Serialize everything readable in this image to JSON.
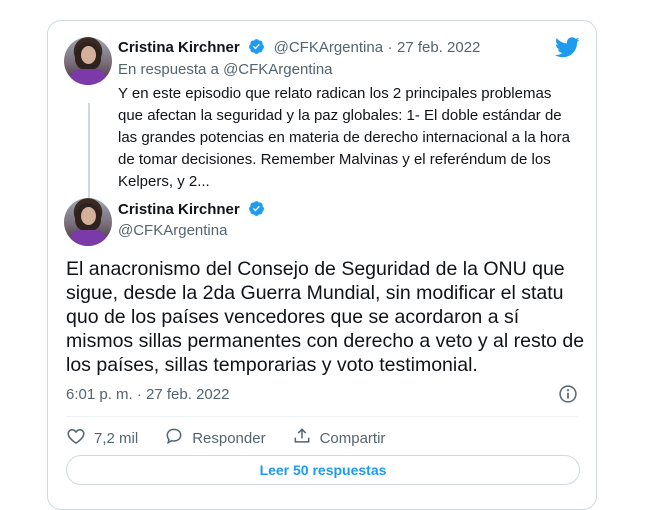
{
  "reply_tweet": {
    "author_name": "Cristina Kirchner",
    "handle": "@CFKArgentina",
    "separator": "·",
    "date": "27 feb. 2022",
    "replying_to": "En respuesta a @CFKArgentina",
    "text": "Y en este episodio que relato radican los 2 principales problemas que afectan la seguridad y la paz globales: 1- El doble estándar de las grandes potencias en materia de derecho internacional a la hora de tomar decisiones. Remember Malvinas y el referéndum de los Kelpers, y 2..."
  },
  "main_tweet": {
    "author_name": "Cristina Kirchner",
    "handle": "@CFKArgentina",
    "text": "El anacronismo del Consejo de Seguridad de la ONU que sigue, desde la 2da Guerra Mundial, sin modificar el statu quo de los países vencedores que se acordaron a sí mismos sillas permanentes con derecho a veto y al resto de los países, sillas temporarias y voto testimonial.",
    "timestamp": "6:01 p. m. · 27 feb. 2022"
  },
  "actions": {
    "likes": "7,2 mil",
    "reply_label": "Responder",
    "share_label": "Compartir"
  },
  "read_replies_label": "Leer 50 respuestas",
  "icons": {
    "brand": "twitter-bird-icon",
    "verified": "verified-badge-icon",
    "like": "heart-icon",
    "reply": "comment-bubble-icon",
    "share": "share-icon",
    "info": "info-icon"
  },
  "colors": {
    "accent": "#1d9bf0",
    "text": "#0f1419",
    "muted": "#536471",
    "border": "#cfd9de"
  }
}
